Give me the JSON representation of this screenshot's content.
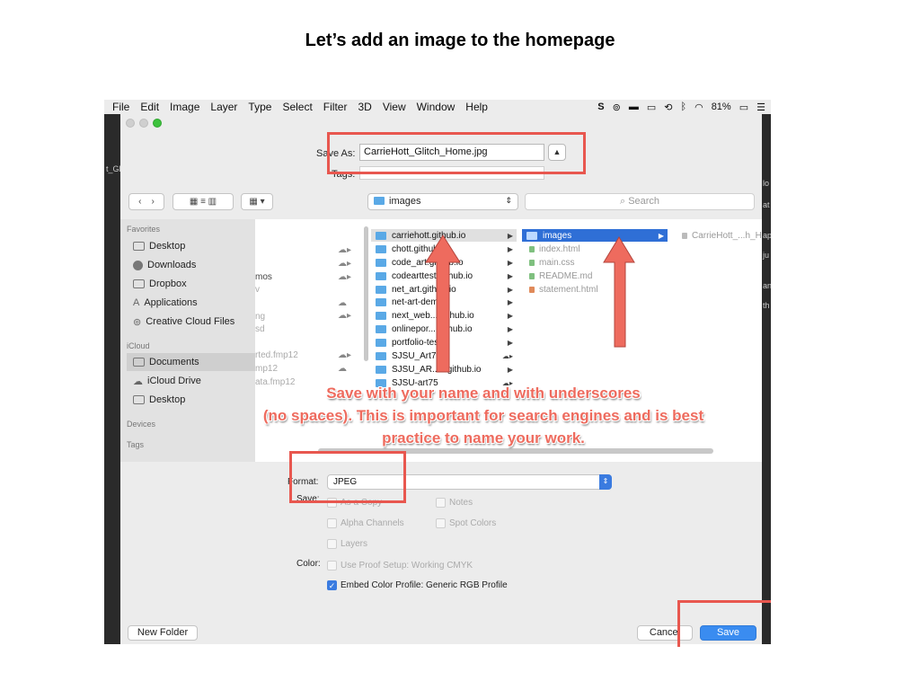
{
  "slide": {
    "title": "Let’s add an image to the homepage"
  },
  "menubar": {
    "items": [
      "File",
      "Edit",
      "Image",
      "Layer",
      "Type",
      "Select",
      "Filter",
      "3D",
      "View",
      "Window",
      "Help"
    ],
    "battery": "81%"
  },
  "background_fragments": [
    "t_Gl",
    "lo",
    "at",
    "ju",
    "an",
    "th",
    "ap"
  ],
  "dialog": {
    "save_as_label": "Save As:",
    "save_as_value": "CarrieHott_Glitch_Home.jpg",
    "tags_label": "Tags:",
    "location": "images",
    "search_placeholder": "Search",
    "sidebar": {
      "favorites_heading": "Favorites",
      "favorites": [
        "Desktop",
        "Downloads",
        "Dropbox",
        "Applications",
        "Creative Cloud Files"
      ],
      "icloud_heading": "iCloud",
      "icloud": [
        "Documents",
        "iCloud Drive",
        "Desktop"
      ],
      "devices_heading": "Devices",
      "tags_heading": "Tags"
    },
    "column1_fragments": [
      "mos",
      "v",
      "ng",
      "sd",
      "rted.fmp12",
      "mp12",
      "ata.fmp12"
    ],
    "column2": [
      "carriehott.github.io",
      "chott.github.io",
      "code_art.github.io",
      "codearttest.github.io",
      "net_art.github.io",
      "net-art-demo",
      "next_web....github.io",
      "onlinepor....github.io",
      "portfolio-test",
      "SJSU_Art74",
      "SJSU_AR...4.github.io",
      "SJSU-art75"
    ],
    "column3_folder": "images",
    "column3_files": [
      "index.html",
      "main.css",
      "README.md",
      "statement.html"
    ],
    "column4_item": "CarrieHott_...h_H",
    "format_label": "Format:",
    "format_value": "JPEG",
    "save_label": "Save:",
    "options": {
      "as_a_copy": "As a Copy",
      "notes": "Notes",
      "alpha_channels": "Alpha Channels",
      "spot_colors": "Spot Colors",
      "layers": "Layers"
    },
    "color_label": "Color:",
    "use_proof_setup": "Use Proof Setup:  Working CMYK",
    "embed_color_profile": "Embed Color Profile:  Generic RGB Profile",
    "new_folder": "New Folder",
    "cancel": "Cancel",
    "save": "Save"
  },
  "annotation": {
    "line1": "Save with your name and with underscores",
    "line2": "(no spaces). This is important for search engines and is best",
    "line3": "practice to name your work."
  },
  "colors": {
    "annotation_red": "#e8574f",
    "accent_blue": "#3a8cf0"
  }
}
